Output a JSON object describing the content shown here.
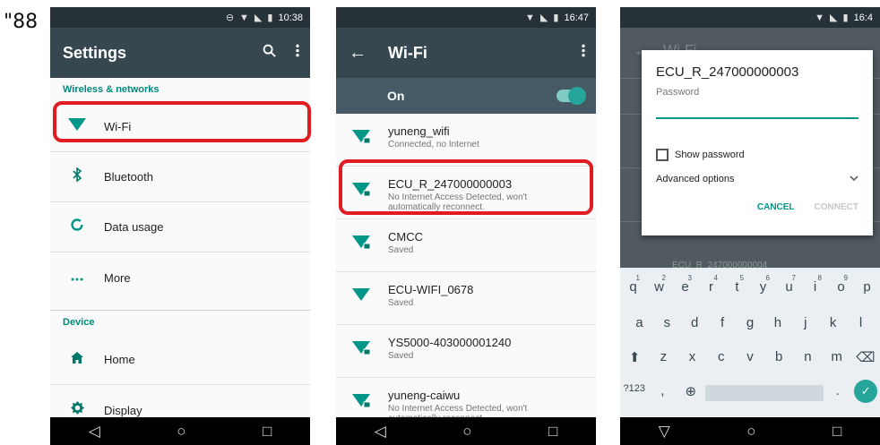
{
  "corner_text": "\"88",
  "phone1": {
    "status": {
      "icons": [
        "⊖",
        "▼",
        "◣",
        "▮"
      ],
      "time": "10:38"
    },
    "title": "Settings",
    "search_icon": "search-icon",
    "menu_icon": "overflow-menu-icon",
    "sections": {
      "wireless": "Wireless & networks",
      "device": "Device"
    },
    "items": [
      {
        "label": "Wi-Fi",
        "icon": "▼"
      },
      {
        "label": "Bluetooth",
        "icon": "✱"
      },
      {
        "label": "Data usage",
        "icon": "◯"
      },
      {
        "label": "More",
        "icon": "•••"
      },
      {
        "label": "Home",
        "icon": "⌂"
      },
      {
        "label": "Display",
        "icon": "☀"
      }
    ],
    "highlight_color": "#e01b22"
  },
  "phone2": {
    "status": {
      "icons": [
        "▼",
        "◣",
        "▮"
      ],
      "time": "16:47"
    },
    "title": "Wi-Fi",
    "back_glyph": "←",
    "menu_glyph": "⋮",
    "on_label": "On",
    "networks": [
      {
        "name": "yuneng_wifi",
        "sub": "Connected, no Internet",
        "locked": true
      },
      {
        "name": "ECU_R_247000000003",
        "sub": "No Internet Access Detected, won't automatically reconnect.",
        "locked": true
      },
      {
        "name": "CMCC",
        "sub": "Saved",
        "locked": true
      },
      {
        "name": "ECU-WIFI_0678",
        "sub": "Saved",
        "locked": false
      },
      {
        "name": "YS5000-403000001240",
        "sub": "Saved",
        "locked": true
      },
      {
        "name": "yuneng-caiwu",
        "sub": "No Internet Access Detected, won't automatically reconnect.",
        "locked": true
      }
    ],
    "accent_color": "#009688"
  },
  "phone3": {
    "status": {
      "icons": [
        "▼",
        "◣",
        "▮"
      ],
      "time": "16:4"
    },
    "bg_title": "Wi-Fi",
    "bg_back": "←",
    "bg_network": "ECU_R_247000000004",
    "dialog": {
      "title": "ECU_R_247000000003",
      "password_label": "Password",
      "show_password": "Show password",
      "advanced": "Advanced options",
      "advanced_chevron": "⌄",
      "cancel": "CANCEL",
      "connect": "CONNECT"
    },
    "keyboard": {
      "row1": [
        {
          "k": "q",
          "h": "1"
        },
        {
          "k": "w",
          "h": "2"
        },
        {
          "k": "e",
          "h": "3"
        },
        {
          "k": "r",
          "h": "4"
        },
        {
          "k": "t",
          "h": "5"
        },
        {
          "k": "y",
          "h": "6"
        },
        {
          "k": "u",
          "h": "7"
        },
        {
          "k": "i",
          "h": "8"
        },
        {
          "k": "o",
          "h": "9"
        },
        {
          "k": "p",
          "h": ""
        }
      ],
      "row2": [
        "a",
        "s",
        "d",
        "f",
        "g",
        "h",
        "j",
        "k",
        "l"
      ],
      "row3": [
        "⬆",
        "z",
        "x",
        "c",
        "v",
        "b",
        "n",
        "m",
        "⌫"
      ],
      "row4": {
        "sym": "?123",
        "comma": ",",
        "globe": "⊕",
        "period": ".",
        "enter": "✓"
      }
    }
  },
  "nav": {
    "back": "◁",
    "home": "○",
    "recents": "□",
    "keyboard_hide": "▽"
  }
}
